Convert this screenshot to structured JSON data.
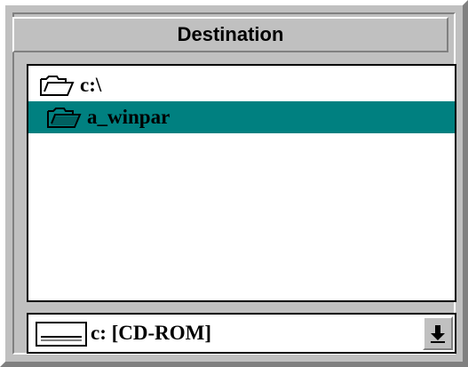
{
  "panel": {
    "title": "Destination"
  },
  "directory_list": {
    "items": [
      {
        "label": "c:\\",
        "icon": "folder-open-icon",
        "selected": false
      },
      {
        "label": "a_winpar",
        "icon": "folder-open-icon",
        "selected": true
      }
    ]
  },
  "drive_select": {
    "value": "c: [CD-ROM]",
    "icon": "drive-icon",
    "button_icon": "arrow-down-icon"
  },
  "colors": {
    "face": "#c0c0c0",
    "selection": "#008080",
    "list_bg": "#ffffff"
  }
}
